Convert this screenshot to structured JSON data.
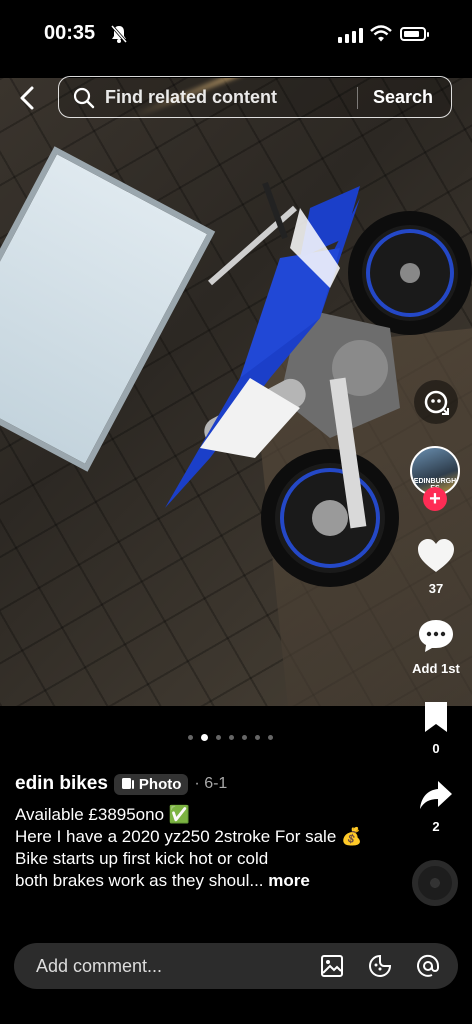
{
  "status": {
    "time": "00:35"
  },
  "search": {
    "placeholder": "Find related content",
    "button": "Search"
  },
  "rail": {
    "avatar_text": "EDINBURGH ES",
    "likes": "37",
    "comments": "Add 1st",
    "saves": "0",
    "shares": "2"
  },
  "carousel": {
    "count": 7,
    "active_index": 1
  },
  "post": {
    "author": "edin bikes",
    "badge": "Photo",
    "date": "· 6-1",
    "lines": [
      "Available £3895ono ✅",
      "Here I have a 2020 yz250 2stroke  For sale 💰",
      "Bike starts up first kick hot or cold",
      "both brakes work as they shoul..."
    ],
    "more": "more"
  },
  "comment_bar": {
    "placeholder": "Add comment..."
  },
  "colors": {
    "accent": "#fe2c55",
    "bike_blue": "#1b3fc9"
  }
}
